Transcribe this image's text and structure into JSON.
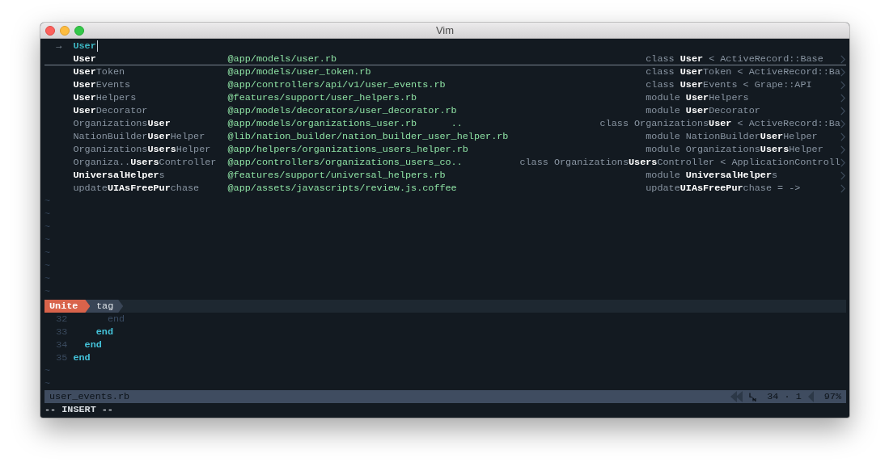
{
  "window": {
    "title": "Vim"
  },
  "unite": {
    "prompt": {
      "symbol": "→",
      "value": "User"
    },
    "results": [
      {
        "name": "**User**",
        "path": "@app/models/user.rb",
        "definition": "class **User** < ActiveRecord::Base",
        "selected": true
      },
      {
        "name": "**User**Token",
        "path": "@app/models/user_token.rb",
        "definition": "class **User**Token < ActiveRecord::Ba",
        "selected": false
      },
      {
        "name": "**User**Events",
        "path": "@app/controllers/api/v1/user_events.rb",
        "definition": "class **User**Events < Grape::API",
        "selected": false
      },
      {
        "name": "**User**Helpers",
        "path": "@features/support/user_helpers.rb",
        "definition": "module **User**Helpers",
        "selected": false
      },
      {
        "name": "**User**Decorator",
        "path": "@app/models/decorators/user_decorator.rb",
        "definition": "module **User**Decorator",
        "selected": false
      },
      {
        "name": "Organizations**User**",
        "path": "@app/models/organizations_user.rb",
        "path_suffix": "..",
        "definition": "class Organizations**User** < ActiveRecord::Ba",
        "selected": false
      },
      {
        "name": "NationBuilder**User**Helper",
        "path": "@lib/nation_builder/nation_builder_user_helper.rb",
        "definition": "module NationBuilder**User**Helper",
        "selected": false
      },
      {
        "name": "Organizations**Users**Helper",
        "path": "@app/helpers/organizations_users_helper.rb",
        "definition": "module Organizations**Users**Helper",
        "selected": false
      },
      {
        "name": "Organiza..**Users**Controller",
        "path": "@app/controllers/organizations_users_co..",
        "definition": "class Organizations**Users**Controller < ApplicationControll",
        "selected": false
      },
      {
        "name": "**UniversalHelper**s",
        "path": "@features/support/universal_helpers.rb",
        "definition": "module **UniversalHelper**s",
        "selected": false
      },
      {
        "name": "update**UIAsFreePur**chase",
        "path": "@app/assets/javascripts/review.js.coffee",
        "definition": "update**UIAsFreePur**chase = ->",
        "selected": false
      }
    ],
    "filler": [
      "~",
      "~",
      "~",
      "~",
      "~",
      "~",
      "~",
      "~"
    ]
  },
  "statusline": {
    "segments": [
      {
        "kind": "plugin",
        "label": "Unite"
      },
      {
        "kind": "source",
        "label": "tag"
      }
    ]
  },
  "editor": {
    "lines": [
      {
        "number": "32",
        "text": "      end",
        "dimmed": true
      },
      {
        "number": "33",
        "text": "    end",
        "dimmed": false
      },
      {
        "number": "34",
        "text": "  end",
        "dimmed": false
      },
      {
        "number": "35",
        "text": "end",
        "dimmed": false
      }
    ],
    "filler": [
      "~",
      "~"
    ]
  },
  "status_bar": {
    "filename": "user_events.rb",
    "position": "34 · 1",
    "percent": "97%"
  },
  "command_line": "-- INSERT --"
}
